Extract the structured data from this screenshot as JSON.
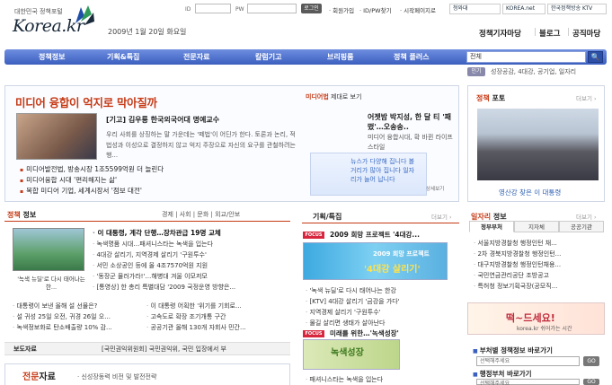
{
  "header": {
    "logo_sub": "대한민국 정책포털",
    "logo_main": "Korea.kr",
    "date": "2009년 1월 20일 화요일",
    "id_label": "ID",
    "pw_label": "PW",
    "login_label": "로그인",
    "top_links": [
      "· 회원가입",
      "· ID/PW찾기",
      "· 시작페이지로"
    ],
    "partners": [
      "청와대",
      "KOREA.net",
      "한국정책방송 KTV"
    ],
    "services": [
      "정책기자마당",
      "블로그",
      "공직마당"
    ]
  },
  "nav": {
    "items": [
      "정책정보",
      "기획&특집",
      "전문자료",
      "칼럼기고",
      "브리핑룸",
      "정책 플러스"
    ],
    "search_scope": "전체",
    "search_button": "🔍",
    "popular_badge": "인기",
    "popular_words": "성장공감, 4대강, 공기업, 일자리"
  },
  "headline": {
    "title": "미디어 융합이 억지로 막아질까",
    "subtitle": "[기고] 김우룡 한국외국어대 명예교수",
    "body": "우리 사회를 상징하는 말 가운데는 '떼법'이 어딘가 한다. 토론과 논리, 적법성과 이성으로 결정하지 않고 억지 주장으로 자신의 요구를 관철하려는 행...",
    "links": [
      "미디어발전법, 방송시장 1조5599억원 더 늘린다",
      "미디어융합 시대 '편리해지는 삶'",
      "복합 미디어 기업, 세계시장서 '점보 대전'"
    ],
    "media_tab": "미디어법",
    "media_tab_rest": "제대로 보기",
    "media_title": "어젯밤 박지성, 한 달 티 '패떴'…오송송..",
    "media_sub": "미디어 융합시대, 확 바뀐 라이프 스타일",
    "news_thumb_text": "뉴스가 다양해 집니다 볼거리가 많아 집니다 일자리가 늘어 납니다",
    "news_thumb_more": "상세보기"
  },
  "photo": {
    "title_red": "정책",
    "title_rest": "포토",
    "more": "더보기 ›",
    "caption": "영산강 찾은 이 대통령"
  },
  "policy_info": {
    "title_red": "정책",
    "title_rest": "정보",
    "tabs": "경제 | 사회 | 문화 | 외교/안보",
    "photo_caption": "'녹색 뉴딜'로 다시 태어나는 한...",
    "items": [
      "이 대통령, 계각 단행…장차관급 19명 교체",
      "녹색명품 시대…패셔니스타는 녹색을 입는다",
      "4대강 살리기, 지역경제 살리기 '구원투수'",
      "서민 소상공인 등에 올 4조7570억원 지원",
      "'동장군 물러가라!'…해병대 겨울 이모저모",
      "[통영상] 한 총리 특별대담 '2009 국정운영 방향은..."
    ],
    "sub_items": [
      "대통령이 보낸 올해 설 선물은?",
      "이 대통령 어획한 '위기를 기회로...",
      "설 귀성 25일 오전, 귀경 26일 오...",
      "고속도로 확장 조기개통 구간",
      "녹색정보화로 탄소배출량 10% 감...",
      "공공기관 올해 130개 자회사 민간..."
    ]
  },
  "press": {
    "label": "보도자료",
    "text": "[국민권익위원회] 국민권익위, 국민 입장에서 부"
  },
  "expert": {
    "title_red": "전문",
    "title_rest": "자료",
    "item": "· 신성장동력 비전 및 발전전략"
  },
  "planning": {
    "title": "기획/특집",
    "more": "더보기 ›",
    "focus_label": "FOCUS",
    "focus1": "2009 희망 프로젝트 '4대강...",
    "img1_t1": "2009 희망 프로젝트",
    "img1_t2": "'4대강 살리기'",
    "items": [
      "'녹색 뉴딜'로 다시 태어나는 한강",
      "[KTV] 4대강 살리기 '금강을 가다'",
      "지역경제 살리기 '구원투수'",
      "물길 살리면 생태가 살아난다"
    ],
    "focus2": "미래를 위한…'녹색성장'",
    "img2_t": "녹색성장",
    "item_last": "패셔니스타는 녹색을 입는다"
  },
  "department": {
    "title_red": "일자리",
    "title_rest": "정보",
    "more": "더보기 ›",
    "tabs": [
      "정부부처",
      "지자체",
      "공공기관"
    ],
    "items": [
      "서울지방경찰청 행정인턴 채...",
      "2차 경북지방경찰청 행정인턴...",
      "대구지방경찰청 행정인턴채용...",
      "국민연금관리공단 조방공고",
      "특허청 정보기획국장(공모직..."
    ],
    "ad_text": "떡~드세요!",
    "ad_url": "korea.kr 쉬어가는 시간",
    "link_box_1": "부처별 정책정보 바로가기",
    "link_box_2": "행정부처 바로가기",
    "select_placeholder": "선택해주세요",
    "go": "GO"
  },
  "colors": {
    "accent": "#c63a16",
    "nav_blue": "#3b5fbf"
  }
}
